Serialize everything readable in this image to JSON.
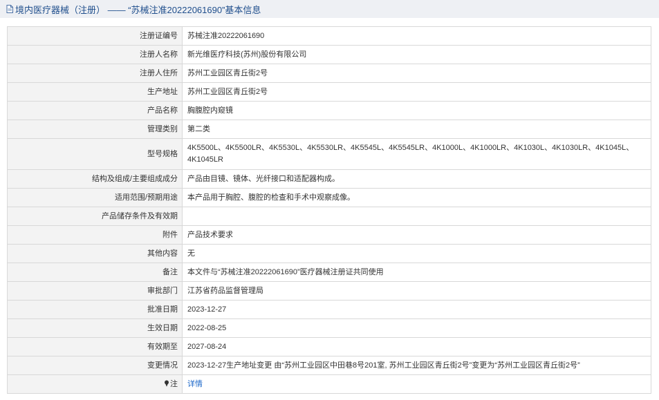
{
  "header": {
    "title": "境内医疗器械（注册） —— “苏械注准20222061690”基本信息",
    "icon": "document-icon"
  },
  "rows": [
    {
      "label": "注册证编号",
      "value": "苏械注准20222061690"
    },
    {
      "label": "注册人名称",
      "value": "新光维医疗科技(苏州)股份有限公司"
    },
    {
      "label": "注册人住所",
      "value": "苏州工业园区青丘街2号"
    },
    {
      "label": "生产地址",
      "value": "苏州工业园区青丘街2号"
    },
    {
      "label": "产品名称",
      "value": "胸腹腔内窥镜"
    },
    {
      "label": "管理类别",
      "value": "第二类"
    },
    {
      "label": "型号规格",
      "value": "4K5500L、4K5500LR、4K5530L、4K5530LR、4K5545L、4K5545LR、4K1000L、4K1000LR、4K1030L、4K1030LR、4K1045L、4K1045LR"
    },
    {
      "label": "结构及组成/主要组成成分",
      "value": "产品由目镜、镜体、光纤接口和适配器构成。"
    },
    {
      "label": "适用范围/预期用途",
      "value": "本产品用于胸腔、腹腔的检查和手术中观察成像。"
    },
    {
      "label": "产品储存条件及有效期",
      "value": ""
    },
    {
      "label": "附件",
      "value": "产品技术要求"
    },
    {
      "label": "其他内容",
      "value": "无"
    },
    {
      "label": "备注",
      "value": "本文件与“苏械注准20222061690”医疗器械注册证共同使用"
    },
    {
      "label": "审批部门",
      "value": "江苏省药品监督管理局"
    },
    {
      "label": "批准日期",
      "value": "2023-12-27"
    },
    {
      "label": "生效日期",
      "value": "2022-08-25"
    },
    {
      "label": "有效期至",
      "value": "2027-08-24"
    },
    {
      "label": "变更情况",
      "value": "2023-12-27生产地址变更 由“苏州工业园区中田巷8号201室, 苏州工业园区青丘街2号”变更为“苏州工业园区青丘街2号”"
    }
  ],
  "note": {
    "label": "注",
    "link": "详情",
    "icon": "pin-icon"
  }
}
